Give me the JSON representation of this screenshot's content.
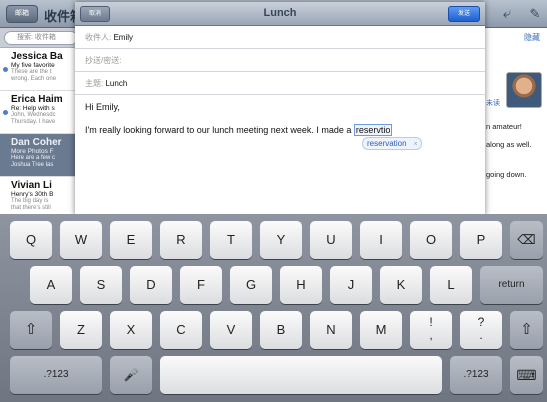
{
  "background_app": {
    "back_label": "邮箱",
    "title": "收件箱",
    "search_placeholder": "搜索: 收件箱",
    "hide_label": "隐藏",
    "read_label": "未读",
    "snippets": [
      "n amateur!",
      "along as well.",
      "going down."
    ],
    "mails": [
      {
        "from": "Jessica Ba",
        "subject": "My five favorite",
        "preview1": "These are the t",
        "preview2": "wrong. Each one"
      },
      {
        "from": "Erica Haim",
        "subject": "Re: Help with s",
        "preview1": "John, Wednesdc",
        "preview2": "Thursday. I have"
      },
      {
        "from": "Dan Coher",
        "subject": "More Photos F",
        "preview1": "Here are a few c",
        "preview2": "Joshua Tree las"
      },
      {
        "from": "Vivian Li",
        "subject": "Henry's 30th B",
        "preview1": "The big day is",
        "preview2": "that there's still"
      }
    ]
  },
  "compose": {
    "cancel_label": "取消",
    "title": "Lunch",
    "send_label": "发送",
    "to_label": "收件人:",
    "to_value": "Emily",
    "cc_label": "抄送/密送:",
    "subject_label": "主题:",
    "subject_value": "Lunch",
    "greeting": "Hi Emily,",
    "body_line": "I'm really looking forward to our lunch meeting next week. I made a ",
    "typed_word": "reservtio",
    "autocorrect_suggestion": "reservation",
    "autocorrect_dismiss": "×"
  },
  "keyboard": {
    "row1": [
      "Q",
      "W",
      "E",
      "R",
      "T",
      "Y",
      "U",
      "I",
      "O",
      "P"
    ],
    "backspace": "⌫",
    "row2": [
      "A",
      "S",
      "D",
      "F",
      "G",
      "H",
      "J",
      "K",
      "L"
    ],
    "return_label": "return",
    "shift": "⇧",
    "row3": [
      "Z",
      "X",
      "C",
      "V",
      "B",
      "N",
      "M"
    ],
    "exclaim_top": "!",
    "exclaim_bottom": ",",
    "question_top": "?",
    "question_bottom": ".",
    "numbers_label": ".?123",
    "dictation": "🎤",
    "hide_keyboard": "⌨"
  }
}
